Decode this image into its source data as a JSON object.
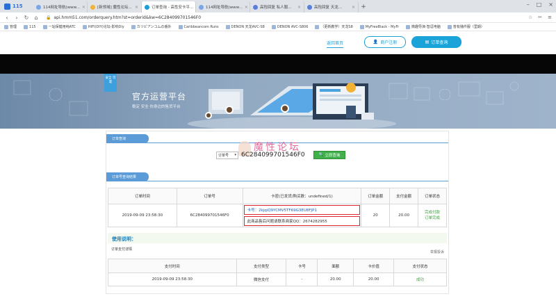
{
  "browser": {
    "brand": "115",
    "tabs": [
      {
        "title": "114网址导航(www...",
        "active": false
      },
      {
        "title": "[新领域] 魔性论坛...",
        "active": false
      },
      {
        "title": "订单查询 - 高性安卡平...",
        "active": true
      },
      {
        "title": "114网址导航(www...",
        "active": false
      },
      {
        "title": "高险回复 私人服...",
        "active": false
      },
      {
        "title": "高险回复 天龙...",
        "active": false
      }
    ],
    "url": "api.hmm51.com/orderquery.htm?st=orderid&kw=6C284099701546F0",
    "bookmarks": [
      "管理",
      "115",
      "一站保健用纯ATC",
      "HIFI(DIY)论坛-影响Diy",
      "カリビアンコムの番外",
      "Caribbeancom Runs",
      "DENON 天龙AVC-S8",
      "DENON AVC-S806",
      "（更新教学）天龙S8",
      "MyFreeBlack - MyFr",
      "微趣导演-智逗电脑",
      "普有播件服（里期）"
    ]
  },
  "header": {
    "home_link": "返回首页",
    "register_button": "商户注册",
    "query_button": "订单查询"
  },
  "banner": {
    "badge": "安全 可靠",
    "title": "官方运营平台",
    "subtitle": "稳定 安全 你身边的售货平台"
  },
  "order_query": {
    "section_title": "订单查询",
    "select_value": "订单号",
    "input_value": "6C284099701546F0",
    "submit_label": "立即查询",
    "watermark": "魔性论坛"
  },
  "results": {
    "section_title": "订单号查询结果",
    "headers": [
      "订单时间",
      "订单号",
      "卡密(已发货/购买数：undefined/1)",
      "订单金额",
      "支付金额",
      "订单状态"
    ],
    "row": {
      "time": "2019-09-09 23:58:30",
      "order_no": "6C284099701546F0",
      "card_code": "卡号：2kjqiQ9YCMV5TF69G3EU8FJP1",
      "card_note": "此商品售后问题请联系商家QQ：2674282955",
      "order_amount": "20",
      "paid_amount": "20.00",
      "status_line1": "完成付款",
      "status_line2": "订单完成"
    }
  },
  "usage": {
    "title": "使用说明：",
    "pay_detail": "订单支付详情",
    "complain": "举报投诉",
    "headers": [
      "支付时间",
      "支付类型",
      "卡号",
      "面额",
      "卡价值",
      "支付状态"
    ],
    "row": [
      "2019-09-09 23:58:30",
      "微信支付",
      "-",
      "20.00",
      "20.00",
      "成功"
    ]
  }
}
